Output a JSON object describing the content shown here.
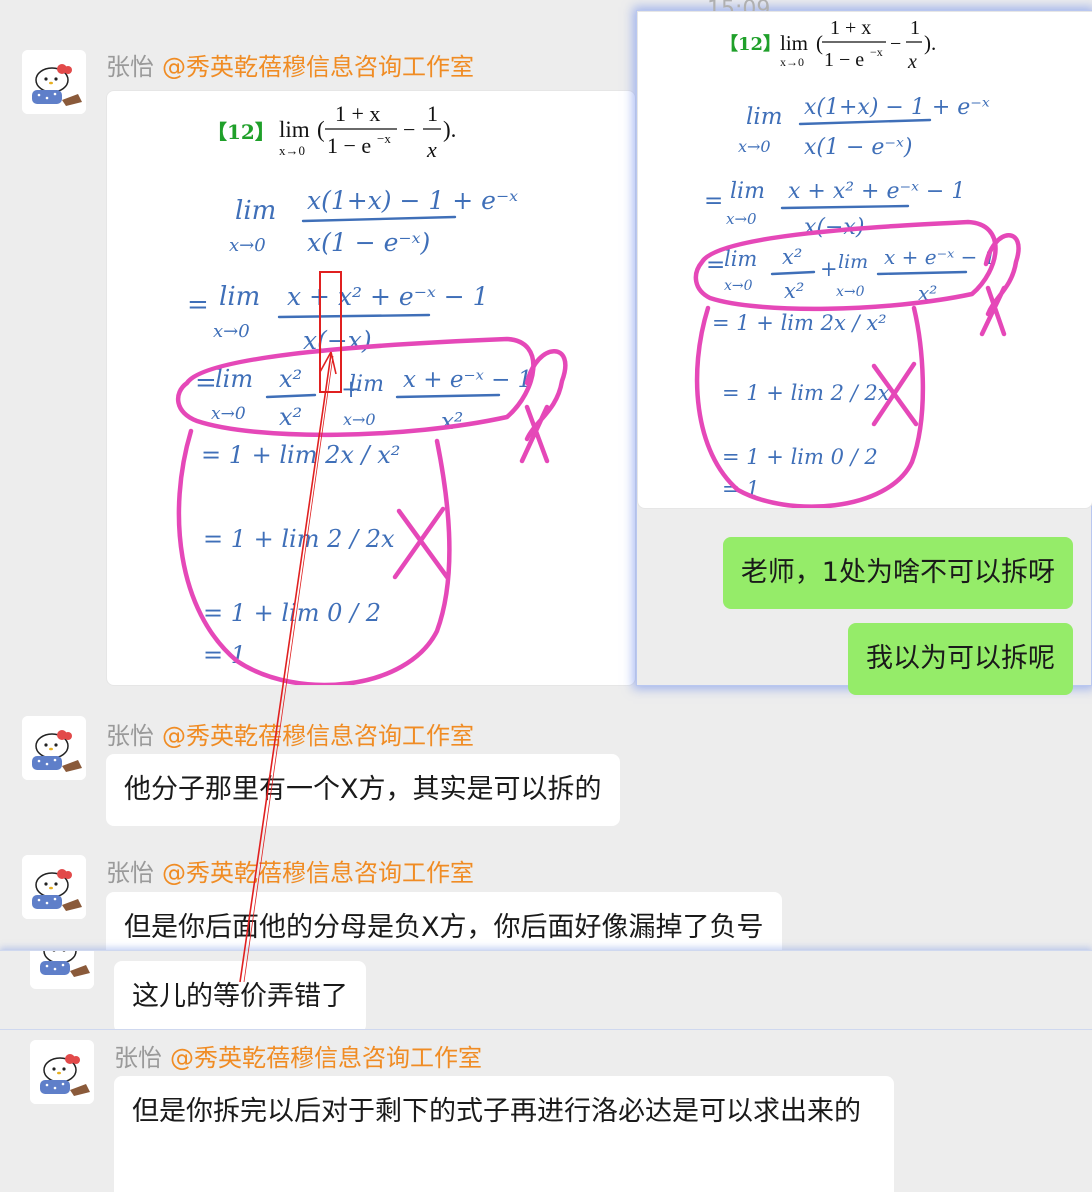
{
  "chat": {
    "time_partial": "15:09",
    "sender_name": "张怡",
    "sender_tag": "@秀英乾蓓穆信息咨询工作室",
    "problem": {
      "number": "【12】",
      "lim": "lim",
      "sub": "x→0",
      "num1": "1 + x",
      "den1": "1 − e",
      "den1_exp": "−x",
      "minus": "−",
      "num2": "1",
      "den2": "x",
      "close": ")."
    },
    "handwriting": {
      "line1_num": "x(1+x) − 1 + e⁻ˣ",
      "line1_den": "x(1 − e⁻ˣ)",
      "line2_num": "x + x² + e⁻ˣ − 1",
      "line2_den": "x(−x)",
      "line3_a_num": "x²",
      "line3_a_den": "x²",
      "line3_b_num": "x + e⁻ˣ − 1",
      "line3_b_den": "x²",
      "line4": "= 1 + lim 2x / x²",
      "line5": "= 1 + lim 2 / 2x",
      "line6": "= 1 + lim 0 / 2",
      "line7": "= 1",
      "lim": "lim",
      "sub": "x→0",
      "eq": "="
    },
    "popup_messages": [
      "老师，1处为啥不可以拆呀",
      "我以为可以拆呢"
    ],
    "messages": [
      "他分子那里有一个X方，其实是可以拆的",
      "但是你后面他的分母是负X方，你后面好像漏掉了负号",
      "这儿的等价弄错了",
      "但是你拆完以后对于剩下的式子再进行洛必达是可以求出来的"
    ]
  },
  "colors": {
    "background": "#ededed",
    "bubble": "#ffffff",
    "my_bubble": "#95ec69",
    "sender_name": "#9a9a9a",
    "sender_tag": "#f08c24",
    "ink": "#3f6fb8",
    "highlight": "#e548b8",
    "annotation": "#e02020"
  },
  "icons": {
    "avatar": "hello-kitty-avatar",
    "annotation_box": "red-rectangle",
    "annotation_arrow": "red-arrow"
  }
}
